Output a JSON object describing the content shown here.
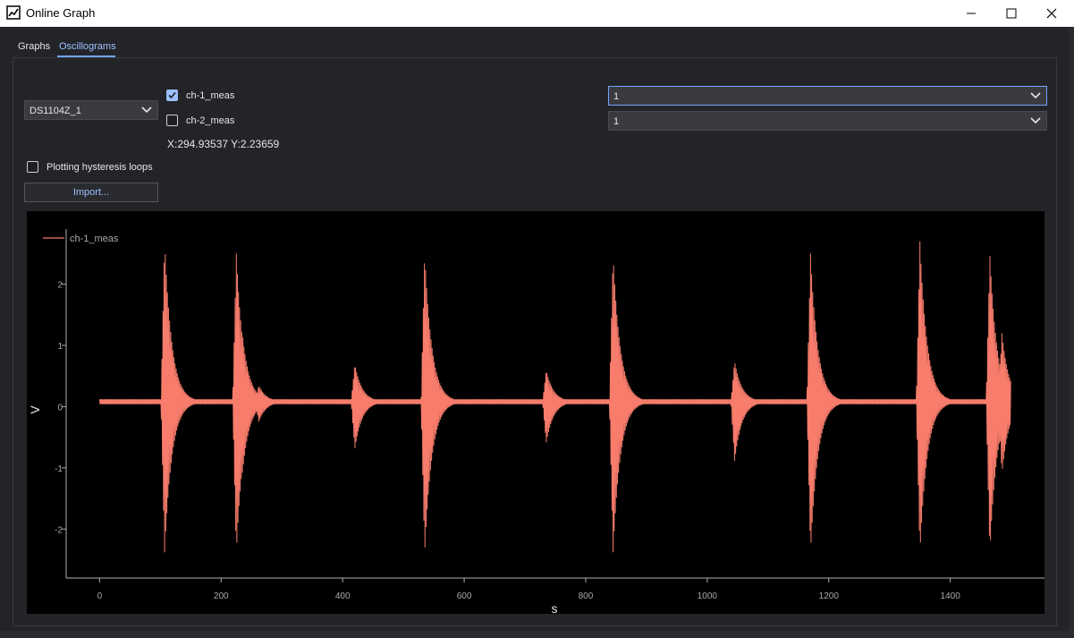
{
  "window": {
    "title": "Online Graph"
  },
  "tabs": [
    {
      "label": "Graphs",
      "active": false
    },
    {
      "label": "Oscillograms",
      "active": true
    }
  ],
  "controls": {
    "device": {
      "value": "DS1104Z_1"
    },
    "channels": [
      {
        "label": "ch-1_meas",
        "checked": true,
        "scale": "1"
      },
      {
        "label": "ch-2_meas",
        "checked": false,
        "scale": "1"
      }
    ],
    "coords": "X:294.93537 Y:2.23659",
    "hysteresis": {
      "label": "Plotting hysteresis loops",
      "checked": false
    },
    "import_label": "Import..."
  },
  "colors": {
    "accent": "#9cc0ff",
    "series": "#f77c6c",
    "plot_bg": "#000000"
  },
  "chart_data": {
    "type": "line",
    "xlabel": "s",
    "ylabel": "V",
    "xlim": [
      -55,
      1555
    ],
    "ylim": [
      -2.8,
      2.9
    ],
    "xticks": [
      0,
      200,
      400,
      600,
      800,
      1000,
      1200,
      1400
    ],
    "yticks": [
      2,
      1,
      0,
      -1,
      -2
    ],
    "grid": false,
    "legend": {
      "position": "top-left",
      "entries": [
        "ch-1_meas"
      ]
    },
    "series": [
      {
        "name": "ch-1_meas",
        "baseline": 0.08,
        "range": [
          0,
          1500
        ],
        "bursts": [
          {
            "x": 107,
            "max": 2.7,
            "min": -2.4
          },
          {
            "x": 225,
            "max": 2.5,
            "min": -2.4
          },
          {
            "x": 235,
            "max": 1.2,
            "min": -1.1
          },
          {
            "x": 262,
            "max": 0.35,
            "min": -0.25
          },
          {
            "x": 420,
            "max": 0.7,
            "min": -0.7
          },
          {
            "x": 535,
            "max": 2.5,
            "min": -2.4
          },
          {
            "x": 735,
            "max": 0.6,
            "min": -0.6
          },
          {
            "x": 845,
            "max": 2.5,
            "min": -2.4
          },
          {
            "x": 1045,
            "max": 0.75,
            "min": -0.9
          },
          {
            "x": 1170,
            "max": 2.5,
            "min": -2.4
          },
          {
            "x": 1350,
            "max": 2.7,
            "min": -2.4
          },
          {
            "x": 1465,
            "max": 2.5,
            "min": -2.4
          },
          {
            "x": 1485,
            "max": 1.2,
            "min": -1.1
          }
        ]
      }
    ]
  }
}
